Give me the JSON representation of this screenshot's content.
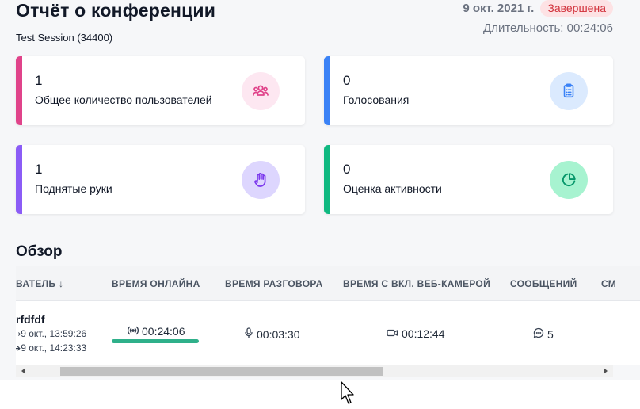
{
  "header": {
    "title": "Отчёт о конференции",
    "session": "Test Session (34400)",
    "date": "9 окт. 2021 г.",
    "status": "Завершена",
    "duration": "Длительность: 00:24:06"
  },
  "cards": [
    {
      "value": "1",
      "label": "Общее количество пользователей",
      "icon": "users-icon",
      "accent": "#e0438a"
    },
    {
      "value": "0",
      "label": "Голосования",
      "icon": "clipboard-icon",
      "accent": "#3b82f6"
    },
    {
      "value": "1",
      "label": "Поднятые руки",
      "icon": "hand-icon",
      "accent": "#8b5cf6"
    },
    {
      "value": "0",
      "label": "Оценка активности",
      "icon": "pie-chart-icon",
      "accent": "#10b981"
    }
  ],
  "overview": {
    "title": "Обзор",
    "columns": {
      "user": "ВАТЕЛЬ ↓",
      "online": "ВРЕМЯ ОНЛАЙНА",
      "talk": "ВРЕМЯ РАЗГОВОРА",
      "webcam": "ВРЕМЯ С ВКЛ. ВЕБ-КАМЕРОЙ",
      "messages": "СООБЩЕНИЙ",
      "more": "СМ"
    },
    "rows": [
      {
        "user": "rfdfdf",
        "joined": "9 окт., 13:59:26",
        "left": "9 окт., 14:23:33",
        "online": "00:24:06",
        "online_fraction": 1.0,
        "talk": "00:03:30",
        "webcam": "00:12:44",
        "messages": "5"
      }
    ]
  },
  "colors": {
    "status_bg": "#fde2e4",
    "status_text": "#d1303a",
    "online_bar": "#2fb08a"
  }
}
